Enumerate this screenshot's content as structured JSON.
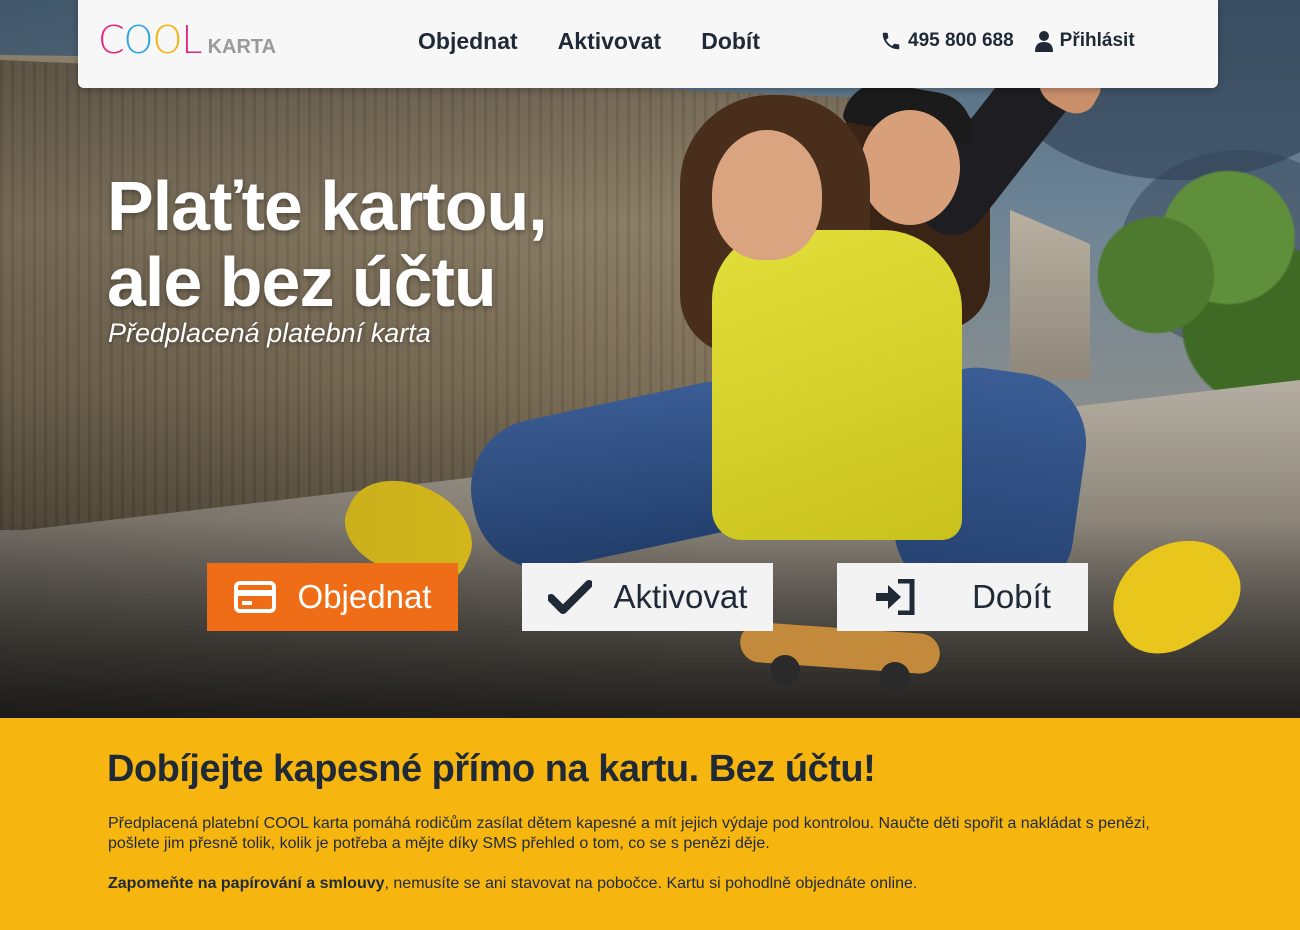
{
  "logo": {
    "cool_letters": [
      {
        "char": "C",
        "color": "#e2247c"
      },
      {
        "char": "O",
        "color": "#2aa7dc"
      },
      {
        "char": "O",
        "color": "#f2b40e"
      },
      {
        "char": "L",
        "color": "#e2247c"
      }
    ],
    "karta": "KARTA"
  },
  "nav": {
    "items": [
      "Objednat",
      "Aktivovat",
      "Dobít"
    ]
  },
  "contact": {
    "phone_icon": "phone-icon",
    "phone": "495 800 688",
    "login_icon": "user-icon",
    "login": "Přihlásit"
  },
  "hero": {
    "title_line1": "Plaťte kartou,",
    "title_line2": "ale bez účtu",
    "subtitle": "Předplacená platební karta"
  },
  "cta": {
    "order": {
      "label": "Objednat",
      "icon": "credit-card-icon"
    },
    "activate": {
      "label": "Aktivovat",
      "icon": "checkmark-icon"
    },
    "topup": {
      "label": "Dobít",
      "icon": "sign-in-icon"
    }
  },
  "promo": {
    "heading": "Dobíjejte kapesné přímo na kartu. Bez účtu!",
    "paragraph1": "Předplacená platební COOL karta pomáhá rodičům zasílat dětem kapesné a mít jejich výdaje pod kontrolou. Naučte děti spořit a nakládat s penězi, pošlete jim přesně tolik, kolik je potřeba a mějte díky SMS přehled o tom, co se s penězi děje.",
    "paragraph2_bold": "Zapomeňte na papírování a smlouvy",
    "paragraph2_rest": ", nemusíte se ani stavovat na pobočce. Kartu si pohodlně objednáte online."
  },
  "colors": {
    "accent_orange": "#ee6d16",
    "promo_yellow": "#f6b60f",
    "text_dark": "#1f2a36"
  }
}
